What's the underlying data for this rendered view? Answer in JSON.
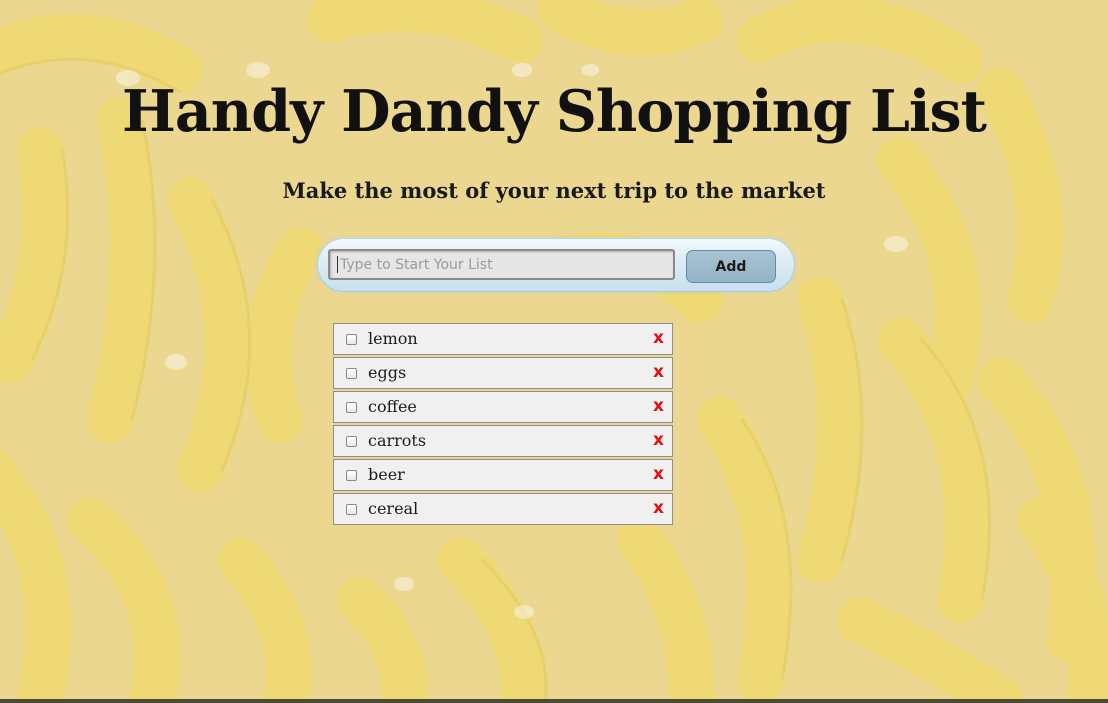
{
  "header": {
    "title": "Handy Dandy Shopping List",
    "subtitle": "Make the most of your next trip to the market"
  },
  "entry": {
    "placeholder": "Type to Start Your List",
    "value": "",
    "add_label": "Add"
  },
  "list": {
    "items": [
      {
        "label": "lemon",
        "checked": false,
        "delete_label": "x"
      },
      {
        "label": "eggs",
        "checked": false,
        "delete_label": "x"
      },
      {
        "label": "coffee",
        "checked": false,
        "delete_label": "x"
      },
      {
        "label": "carrots",
        "checked": false,
        "delete_label": "x"
      },
      {
        "label": "beer",
        "checked": false,
        "delete_label": "x"
      },
      {
        "label": "cereal",
        "checked": false,
        "delete_label": "x"
      }
    ]
  },
  "colors": {
    "background": "#e9d27a",
    "banana": "#f4d640",
    "delete": "#e01010",
    "add_button": "#93b4c6"
  },
  "icons": {
    "item_checkbox": "checkbox-icon",
    "item_delete": "close-icon"
  }
}
